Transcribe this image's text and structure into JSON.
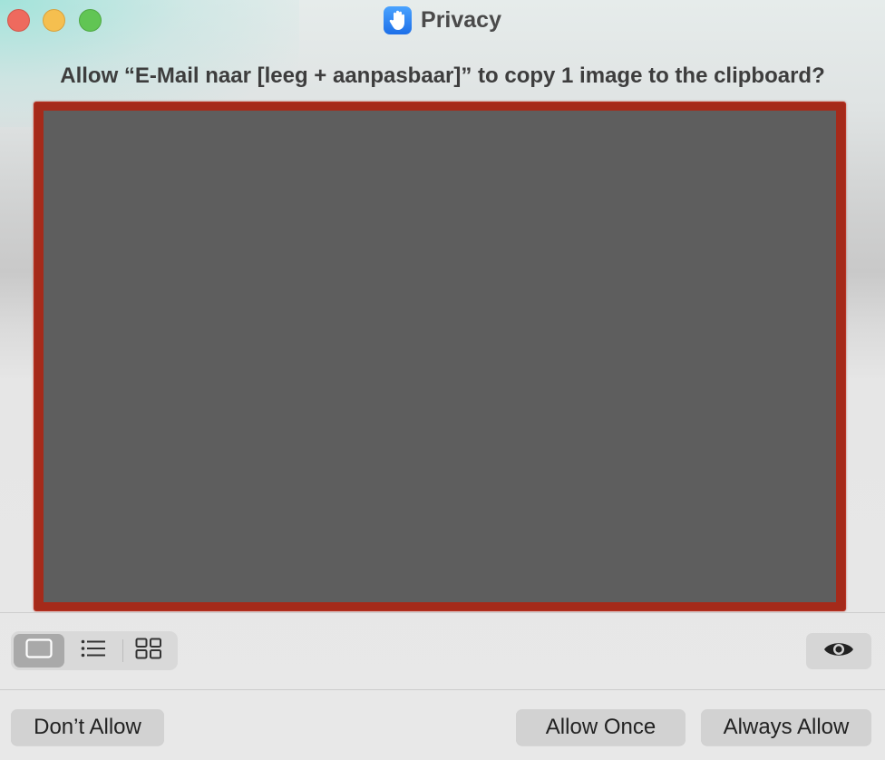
{
  "window": {
    "title": "Privacy",
    "app_icon": "raised-hand-icon"
  },
  "prompt": {
    "text": "Allow “E-Mail naar [leeg + aanpasbaar]” to copy 1 image to the clipboard?"
  },
  "preview": {
    "image_fill": "#5e5e5e",
    "frame_color": "#a52a1a"
  },
  "toolbar": {
    "view_modes": [
      {
        "icon": "single-view-icon",
        "selected": true
      },
      {
        "icon": "list-view-icon",
        "selected": false
      },
      {
        "icon": "grid-view-icon",
        "selected": false
      }
    ],
    "preview_icon": "eye-icon"
  },
  "actions": {
    "dont_allow": "Don’t Allow",
    "allow_once": "Allow Once",
    "always_allow": "Always Allow"
  },
  "colors": {
    "close": "#ee6a5e",
    "minimize": "#f5bf4f",
    "zoom": "#61c554",
    "accent": "#1d6fe8"
  }
}
